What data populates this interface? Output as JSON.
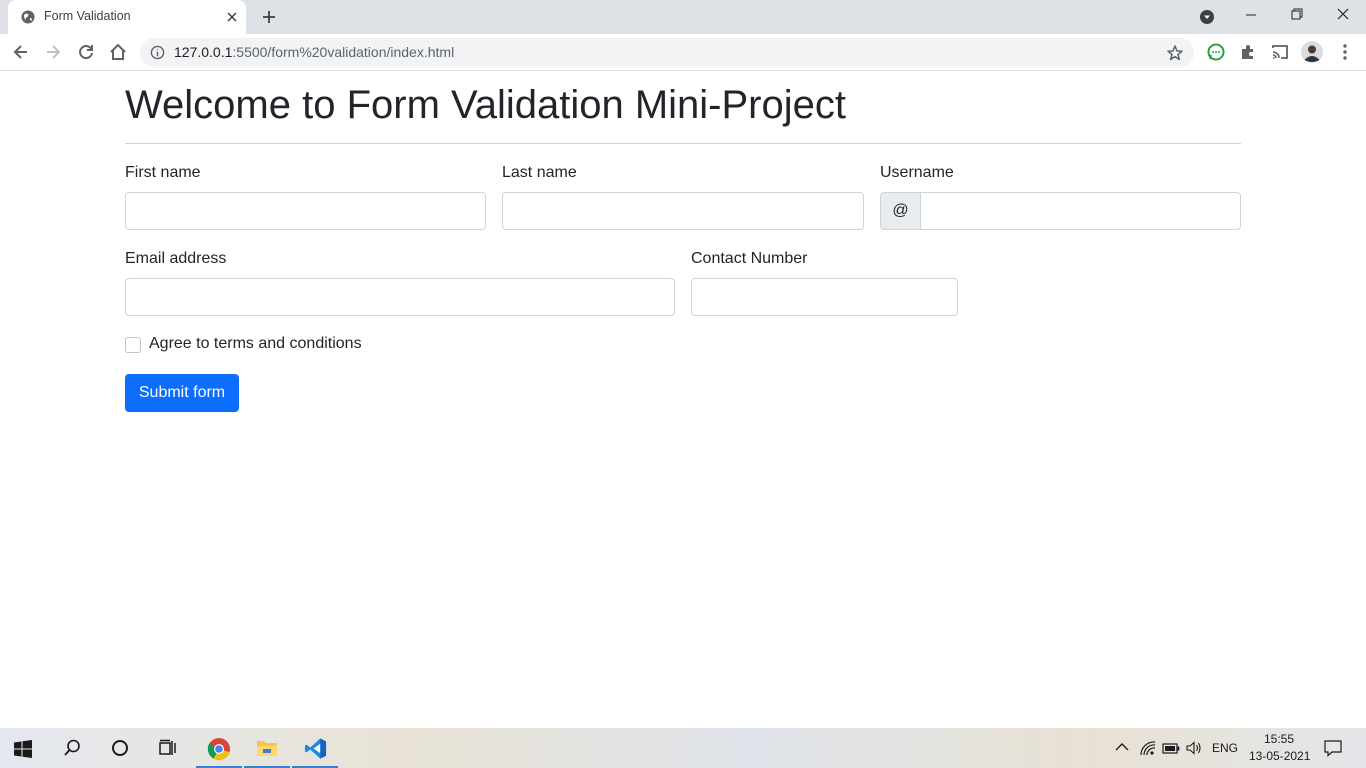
{
  "browser": {
    "tab_title": "Form Validation",
    "url_host": "127.0.0.1",
    "url_rest": ":5500/form%20validation/index.html"
  },
  "page": {
    "heading": "Welcome to Form Validation Mini-Project",
    "fields": {
      "first_name_label": "First name",
      "first_name_value": "",
      "last_name_label": "Last name",
      "last_name_value": "",
      "username_label": "Username",
      "username_prefix": "@",
      "username_value": "",
      "email_label": "Email address",
      "email_value": "",
      "contact_label": "Contact Number",
      "contact_value": ""
    },
    "agree_label": "Agree to terms and conditions",
    "agree_checked": false,
    "submit_label": "Submit form",
    "accent_color": "#0d6efd"
  },
  "taskbar": {
    "language": "ENG",
    "time": "15:55",
    "date": "13-05-2021"
  }
}
